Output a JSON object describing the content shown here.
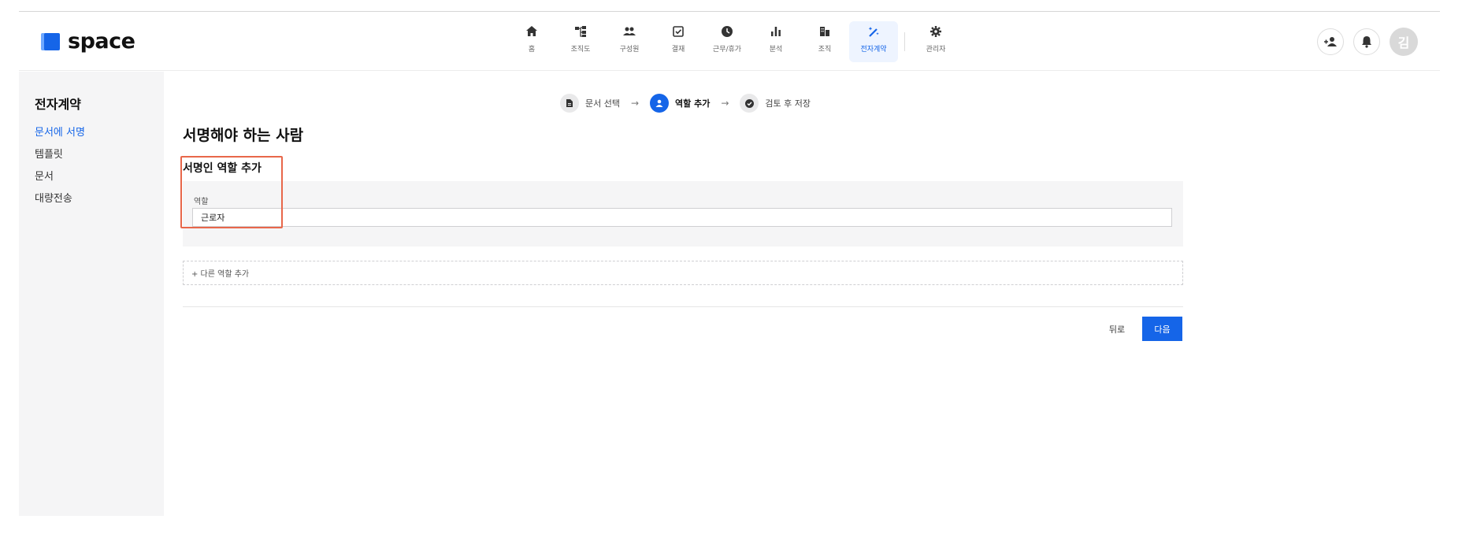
{
  "app": {
    "logo_text": "space",
    "colors": {
      "accent": "#1565e8",
      "highlight": "#e8674a",
      "panel_bg": "#f5f5f6"
    }
  },
  "nav": {
    "items": [
      {
        "label": "홈",
        "icon": "home-icon"
      },
      {
        "label": "조직도",
        "icon": "org-chart-icon"
      },
      {
        "label": "구성원",
        "icon": "members-icon"
      },
      {
        "label": "결재",
        "icon": "approval-icon"
      },
      {
        "label": "근무/휴가",
        "icon": "clock-icon"
      },
      {
        "label": "분석",
        "icon": "bar-chart-icon"
      },
      {
        "label": "조직",
        "icon": "building-icon"
      },
      {
        "label": "전자계약",
        "icon": "magic-wand-icon",
        "active": true
      },
      {
        "label": "관리자",
        "icon": "gear-icon"
      }
    ],
    "right": {
      "add_member_icon": "person-add-icon",
      "notification_icon": "bell-icon",
      "avatar_initial": "김"
    }
  },
  "sidebar": {
    "title": "전자계약",
    "items": [
      {
        "label": "문서에 서명",
        "active": true
      },
      {
        "label": "템플릿"
      },
      {
        "label": "문서"
      },
      {
        "label": "대량전송"
      }
    ]
  },
  "steps": [
    {
      "label": "문서 선택",
      "icon": "document-icon"
    },
    {
      "label": "역할 추가",
      "icon": "person-icon",
      "active": true
    },
    {
      "label": "검토 후 저장",
      "icon": "check-circle-icon"
    }
  ],
  "main": {
    "page_title": "서명해야 하는 사람",
    "section_title": "서명인 역할 추가",
    "role_label": "역할",
    "role_value": "근로자",
    "add_role": "+ 다른 역할 추가",
    "back_label": "뒤로",
    "next_label": "다음"
  }
}
